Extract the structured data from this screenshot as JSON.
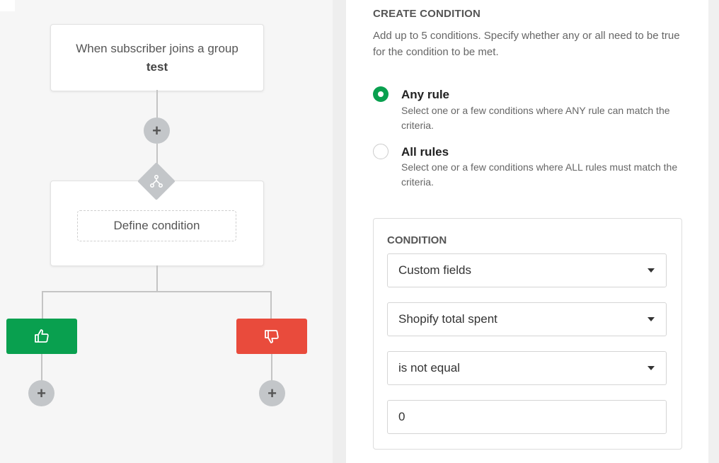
{
  "workflow": {
    "trigger_title": "When subscriber joins a group",
    "trigger_group": "test",
    "define_condition_label": "Define condition",
    "plus_symbol": "+",
    "icons": {
      "add": "plus-icon",
      "condition": "split-icon",
      "yes": "thumbs-up-icon",
      "no": "thumbs-down-icon"
    },
    "colors": {
      "yes": "#09a04f",
      "no": "#e94b3c",
      "connector": "#c4c4c4"
    }
  },
  "panel": {
    "title": "CREATE CONDITION",
    "description": "Add up to 5 conditions. Specify whether any or all need to be true for the condition to be met.",
    "rules": [
      {
        "label": "Any rule",
        "description": "Select one or a few conditions where ANY rule can match the criteria.",
        "selected": true
      },
      {
        "label": "All rules",
        "description": "Select one or a few conditions where ALL rules must match the criteria.",
        "selected": false
      }
    ],
    "condition": {
      "label": "CONDITION",
      "field_type": "Custom fields",
      "field": "Shopify total spent",
      "operator": "is not equal",
      "value": "0"
    }
  }
}
